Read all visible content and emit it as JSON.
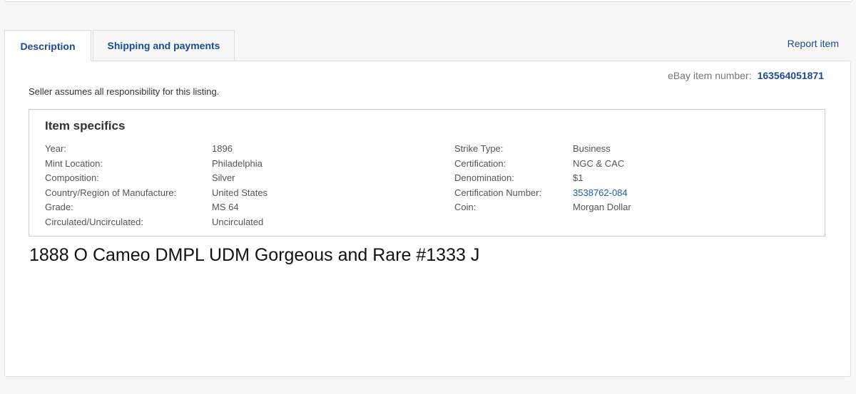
{
  "tabs": {
    "description": "Description",
    "shipping": "Shipping and payments"
  },
  "report_item": "Report item",
  "item_number": {
    "label": "eBay item number:",
    "value": "163564051871"
  },
  "seller_note": "Seller assumes all responsibility for this listing.",
  "item_specifics": {
    "title": "Item specifics",
    "left": [
      {
        "label": "Year:",
        "value": "1896"
      },
      {
        "label": "Mint Location:",
        "value": "Philadelphia"
      },
      {
        "label": "Composition:",
        "value": "Silver"
      },
      {
        "label": "Country/Region of Manufacture:",
        "value": "United States"
      },
      {
        "label": "Grade:",
        "value": "MS 64"
      },
      {
        "label": "Circulated/Uncirculated:",
        "value": "Uncirculated"
      }
    ],
    "right": [
      {
        "label": "Strike Type:",
        "value": "Business"
      },
      {
        "label": "Certification:",
        "value": "NGC & CAC"
      },
      {
        "label": "Denomination:",
        "value": "$1"
      },
      {
        "label": "Certification Number:",
        "value": "3538762-084"
      },
      {
        "label": "Coin:",
        "value": "Morgan Dollar"
      }
    ]
  },
  "listing_title": "1888 O Cameo DMPL UDM Gorgeous and Rare #1333 J"
}
